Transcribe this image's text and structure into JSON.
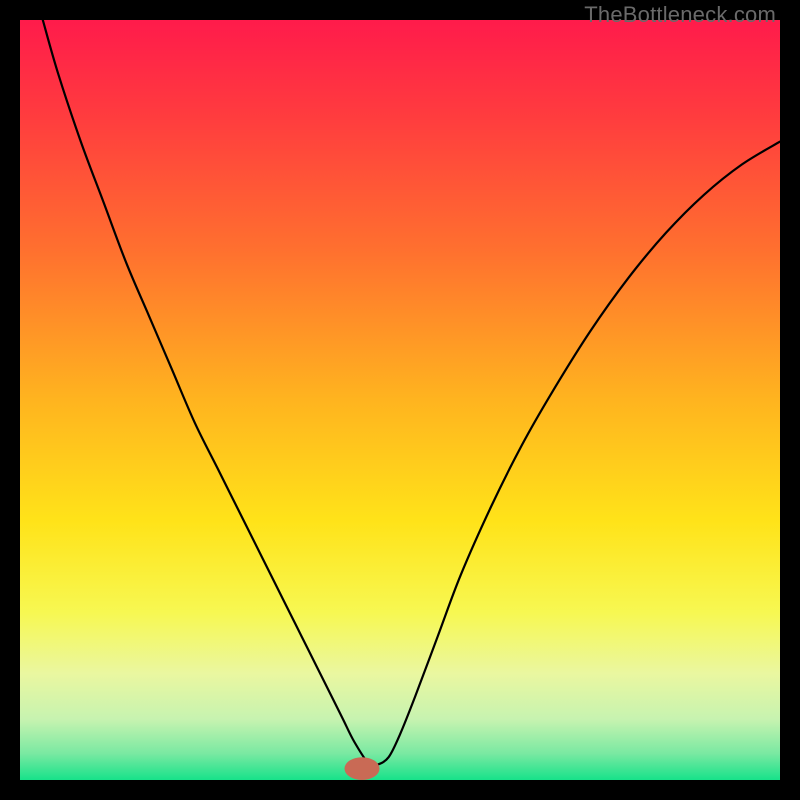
{
  "watermark": "TheBottleneck.com",
  "chart_data": {
    "type": "line",
    "title": "",
    "xlabel": "",
    "ylabel": "",
    "xlim": [
      0,
      100
    ],
    "ylim": [
      0,
      100
    ],
    "grid": false,
    "legend": false,
    "annotations": [],
    "background": {
      "type": "vertical-gradient",
      "stops": [
        {
          "pos": 0.0,
          "color": "#ff1b4b"
        },
        {
          "pos": 0.12,
          "color": "#ff3a3f"
        },
        {
          "pos": 0.3,
          "color": "#ff6f2f"
        },
        {
          "pos": 0.5,
          "color": "#ffb41f"
        },
        {
          "pos": 0.66,
          "color": "#ffe319"
        },
        {
          "pos": 0.78,
          "color": "#f7f852"
        },
        {
          "pos": 0.86,
          "color": "#eaf7a0"
        },
        {
          "pos": 0.92,
          "color": "#c7f3b0"
        },
        {
          "pos": 0.965,
          "color": "#7ae9a2"
        },
        {
          "pos": 1.0,
          "color": "#17e28a"
        }
      ]
    },
    "marker": {
      "x": 45,
      "y": 1.5,
      "color": "#c96a55",
      "rx": 2.3,
      "ry": 1.5
    },
    "series": [
      {
        "name": "bottleneck-curve",
        "color": "#000000",
        "width": 2.2,
        "x": [
          3,
          5,
          8,
          11,
          14,
          17,
          20,
          23,
          26,
          29,
          32,
          35,
          37,
          39,
          41,
          42.5,
          44,
          46,
          47,
          48.5,
          50,
          52,
          55,
          58,
          62,
          66,
          70,
          75,
          80,
          85,
          90,
          95,
          100
        ],
        "y": [
          100,
          93,
          84,
          76,
          68,
          61,
          54,
          47,
          41,
          35,
          29,
          23,
          19,
          15,
          11,
          8,
          5,
          2,
          2,
          3,
          6,
          11,
          19,
          27,
          36,
          44,
          51,
          59,
          66,
          72,
          77,
          81,
          84
        ]
      }
    ]
  }
}
